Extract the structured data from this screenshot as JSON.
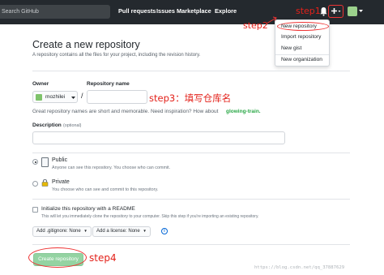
{
  "header": {
    "search_placeholder": "Search GitHub",
    "nav": [
      "Pull requests",
      "Issues",
      "Marketplace",
      "Explore"
    ]
  },
  "dropdown": {
    "items": [
      "New repository",
      "Import repository",
      "New gist",
      "New organization"
    ]
  },
  "annotations": {
    "step1": "step1",
    "step2": "step2",
    "step3": "step3：填写仓库名",
    "step4": "step4"
  },
  "form": {
    "title": "Create a new repository",
    "subtitle": "A repository contains all the files for your project, including the revision history.",
    "owner_label": "Owner",
    "owner_value": "mozhilei",
    "repo_label": "Repository name",
    "slash": "/",
    "hint": "Great repository names are short and memorable. Need inspiration? How about",
    "hint_suggestion": "glowing-train.",
    "description_label": "Description",
    "description_optional": "(optional)",
    "public_title": "Public",
    "public_desc": "Anyone can see this repository. You choose who can commit.",
    "private_title": "Private",
    "private_desc": "You choose who can see and commit to this repository.",
    "init_title": "Initialize this repository with a README",
    "init_desc": "This will let you immediately clone the repository to your computer. Skip this step if you're importing an existing repository.",
    "gitignore_btn": "Add .gitignore: None",
    "license_btn": "Add a license: None",
    "info_icon_text": "i",
    "create_btn": "Create repository"
  },
  "watermark": "https://blog.csdn.net/qq_37887629",
  "colors": {
    "header_bg": "#24292e",
    "annotation": "#e3211a",
    "create_btn": "#94d3a2",
    "suggestion": "#28a745"
  }
}
